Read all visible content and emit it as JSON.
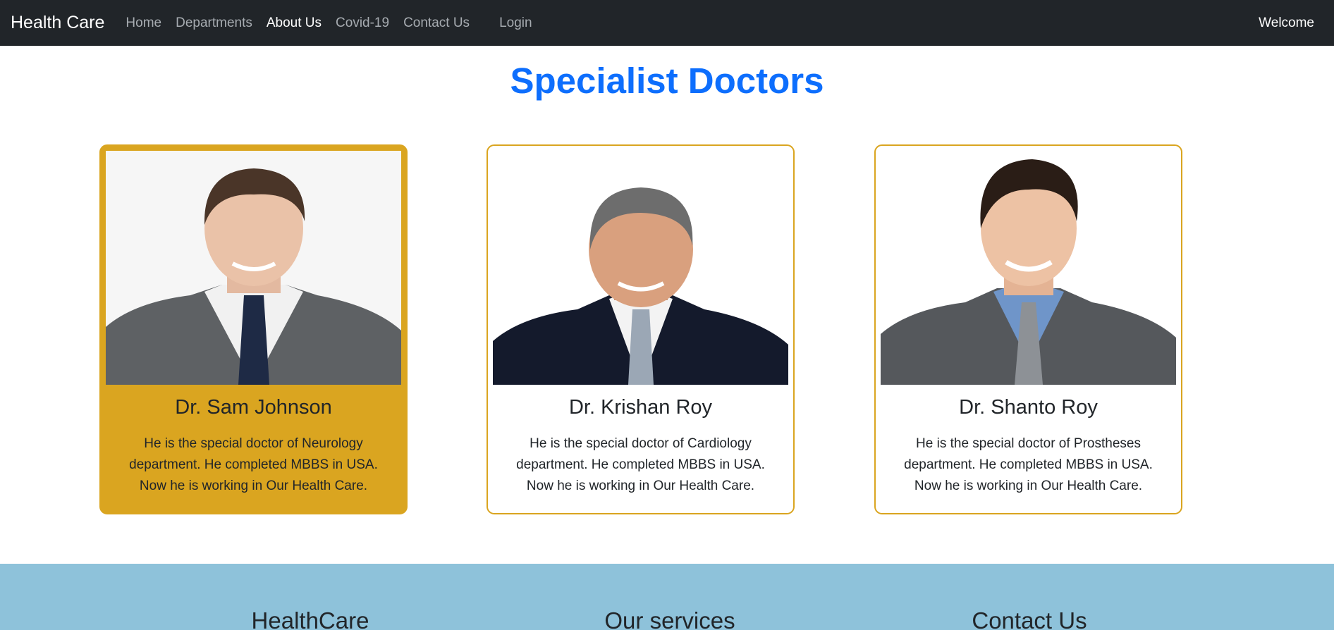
{
  "navbar": {
    "brand": "Health Care",
    "links": [
      {
        "label": "Home",
        "active": false
      },
      {
        "label": "Departments",
        "active": false
      },
      {
        "label": "About Us",
        "active": true
      },
      {
        "label": "Covid-19",
        "active": false
      },
      {
        "label": "Contact Us",
        "active": false
      }
    ],
    "login": "Login",
    "welcome": "Welcome"
  },
  "section": {
    "title": "Specialist Doctors"
  },
  "doctors": [
    {
      "name": "Dr. Sam Johnson",
      "description": "He is the special doctor of Neurology department. He completed MBBS in USA. Now he is working in Our Health Care.",
      "highlighted": true
    },
    {
      "name": "Dr. Krishan Roy",
      "description": "He is the special doctor of Cardiology department. He completed MBBS in USA. Now he is working in Our Health Care.",
      "highlighted": false
    },
    {
      "name": "Dr. Shanto Roy",
      "description": "He is the special doctor of Prostheses department. He completed MBBS in USA. Now he is working in Our Health Care.",
      "highlighted": false
    }
  ],
  "footer": {
    "columns": [
      "HealthCare",
      "Our services",
      "Contact Us"
    ]
  },
  "colors": {
    "navbar_bg": "#212529",
    "title": "#0d6efd",
    "card_accent": "#daa520",
    "footer_bg": "#8ec2da"
  }
}
